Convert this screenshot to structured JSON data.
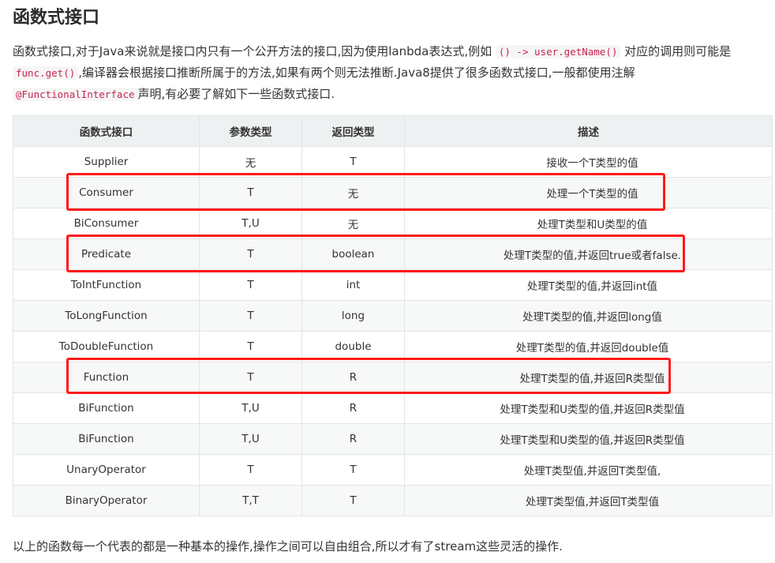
{
  "heading": "函数式接口",
  "intro": {
    "line1_text": "函数式接口,对于Java来说就是接口内只有一个公开方法的接口,因为使用lanbda表达式,例如",
    "line1_code": "() -> user.getName()",
    "line1_tail": "对应的调用则可能是",
    "line2_code": "func.get()",
    "line2_text": ",编译器会根据接口推断所属于的方法,如果有两个则无法推断.Java8提供了很多函数式接口,一般都使用注解",
    "line3_code": "@FunctionalInterface",
    "line3_text": "声明,有必要了解如下一些函数式接口."
  },
  "table": {
    "headers": [
      "函数式接口",
      "参数类型",
      "返回类型",
      "描述"
    ],
    "rows": [
      [
        "Supplier",
        "无",
        "T",
        "接收一个T类型的值"
      ],
      [
        "Consumer",
        "T",
        "无",
        "处理一个T类型的值"
      ],
      [
        "BiConsumer",
        "T,U",
        "无",
        "处理T类型和U类型的值"
      ],
      [
        "Predicate",
        "T",
        "boolean",
        "处理T类型的值,并返回true或者false."
      ],
      [
        "ToIntFunction",
        "T",
        "int",
        "处理T类型的值,并返回int值"
      ],
      [
        "ToLongFunction",
        "T",
        "long",
        "处理T类型的值,并返回long值"
      ],
      [
        "ToDoubleFunction",
        "T",
        "double",
        "处理T类型的值,并返回double值"
      ],
      [
        "Function",
        "T",
        "R",
        "处理T类型的值,并返回R类型值"
      ],
      [
        "BiFunction",
        "T,U",
        "R",
        "处理T类型和U类型的值,并返回R类型值"
      ],
      [
        "BiFunction",
        "T,U",
        "R",
        "处理T类型和U类型的值,并返回R类型值"
      ],
      [
        "UnaryOperator",
        "T",
        "T",
        "处理T类型值,并返回T类型值,"
      ],
      [
        "BinaryOperator",
        "T,T",
        "T",
        "处理T类型值,并返回T类型值"
      ]
    ]
  },
  "highlights": [
    "Consumer",
    "Predicate",
    "Function"
  ],
  "highlight_color": "#ff1a1a",
  "outro": "以上的函数每一个代表的都是一种基本的操作,操作之间可以自由组合,所以才有了stream这些灵活的操作."
}
